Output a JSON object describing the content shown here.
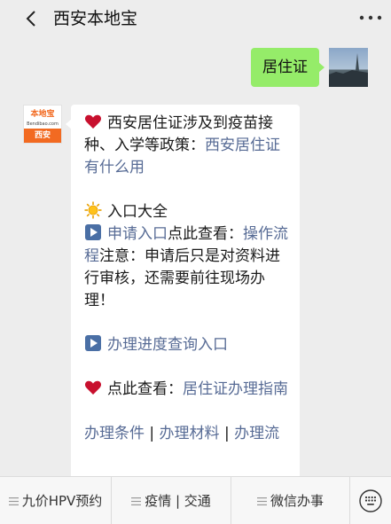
{
  "header": {
    "title": "西安本地宝"
  },
  "chat": {
    "outgoing_text": "居住证",
    "bot_logo": {
      "brand": "本地宝",
      "url": "Bendibao.com",
      "city": "西安"
    },
    "reply": {
      "p1_text": "西安居住证涉及到疫苗接种、入学等政策：",
      "p1_link": "西安居住证有什么用",
      "p2_title": "入口大全",
      "p3_link": "申请入口",
      "p3_text": "点此查看：",
      "p3_link2": "操作流程",
      "p3_text2": "注意：申请后只是对资料进行审核，还需要前往现场办理！",
      "p4_link": "办理进度查询入口",
      "p5_text": "点此查看：",
      "p5_link": "居住证办理指南",
      "p6_link1": "办理条件",
      "p6_sep1": " | ",
      "p6_link2": "办理材料",
      "p6_sep2": " | ",
      "p6_link3": "办理流"
    }
  },
  "menu": {
    "items": [
      {
        "label": "九价HPV预约"
      },
      {
        "label": "疫情 | 交通"
      },
      {
        "label": "微信办事"
      }
    ]
  },
  "colors": {
    "outgoing_bubble": "#95ec69",
    "link": "#576b95",
    "brand_orange": "#f26a21"
  }
}
